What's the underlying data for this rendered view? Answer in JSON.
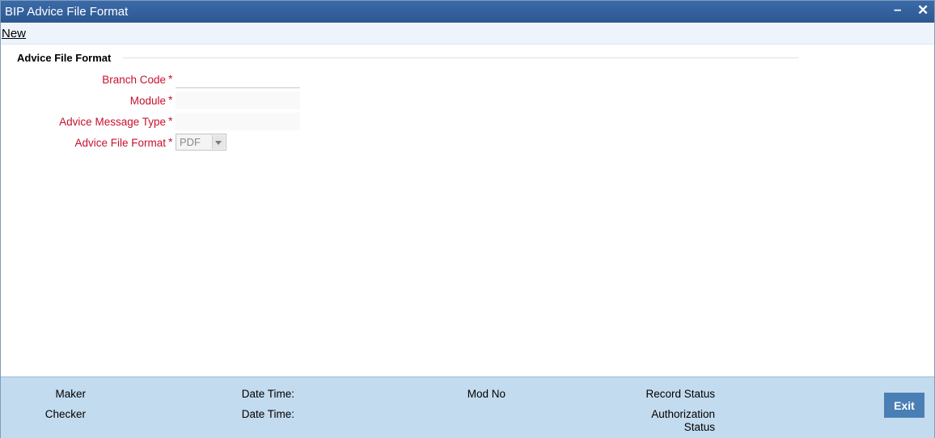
{
  "window": {
    "title": "BIP Advice File Format",
    "minimize_glyph": "–",
    "close_glyph": "✕"
  },
  "toolbar": {
    "new_label": "New"
  },
  "form": {
    "section_title": "Advice File Format",
    "required_marker": "*",
    "fields": {
      "branch_code": {
        "label": "Branch Code",
        "value": ""
      },
      "module": {
        "label": "Module",
        "value": ""
      },
      "advice_message_type": {
        "label": "Advice Message Type",
        "value": ""
      },
      "advice_file_format": {
        "label": "Advice File Format",
        "value": "PDF"
      }
    }
  },
  "footer": {
    "maker_label": "Maker",
    "checker_label": "Checker",
    "maker_datetime_label": "Date Time:",
    "checker_datetime_label": "Date Time:",
    "mod_no_label": "Mod No",
    "record_status_label": "Record Status",
    "authorization_status_line1": "Authorization",
    "authorization_status_line2": "Status",
    "exit_label": "Exit"
  },
  "colors": {
    "titlebar": "#2c5891",
    "required_label": "#c8102e",
    "footer_bg": "#c3dbee",
    "exit_button": "#4a7fb5"
  },
  "icons": [
    "minimize-icon",
    "close-icon",
    "dropdown-arrow-icon"
  ]
}
